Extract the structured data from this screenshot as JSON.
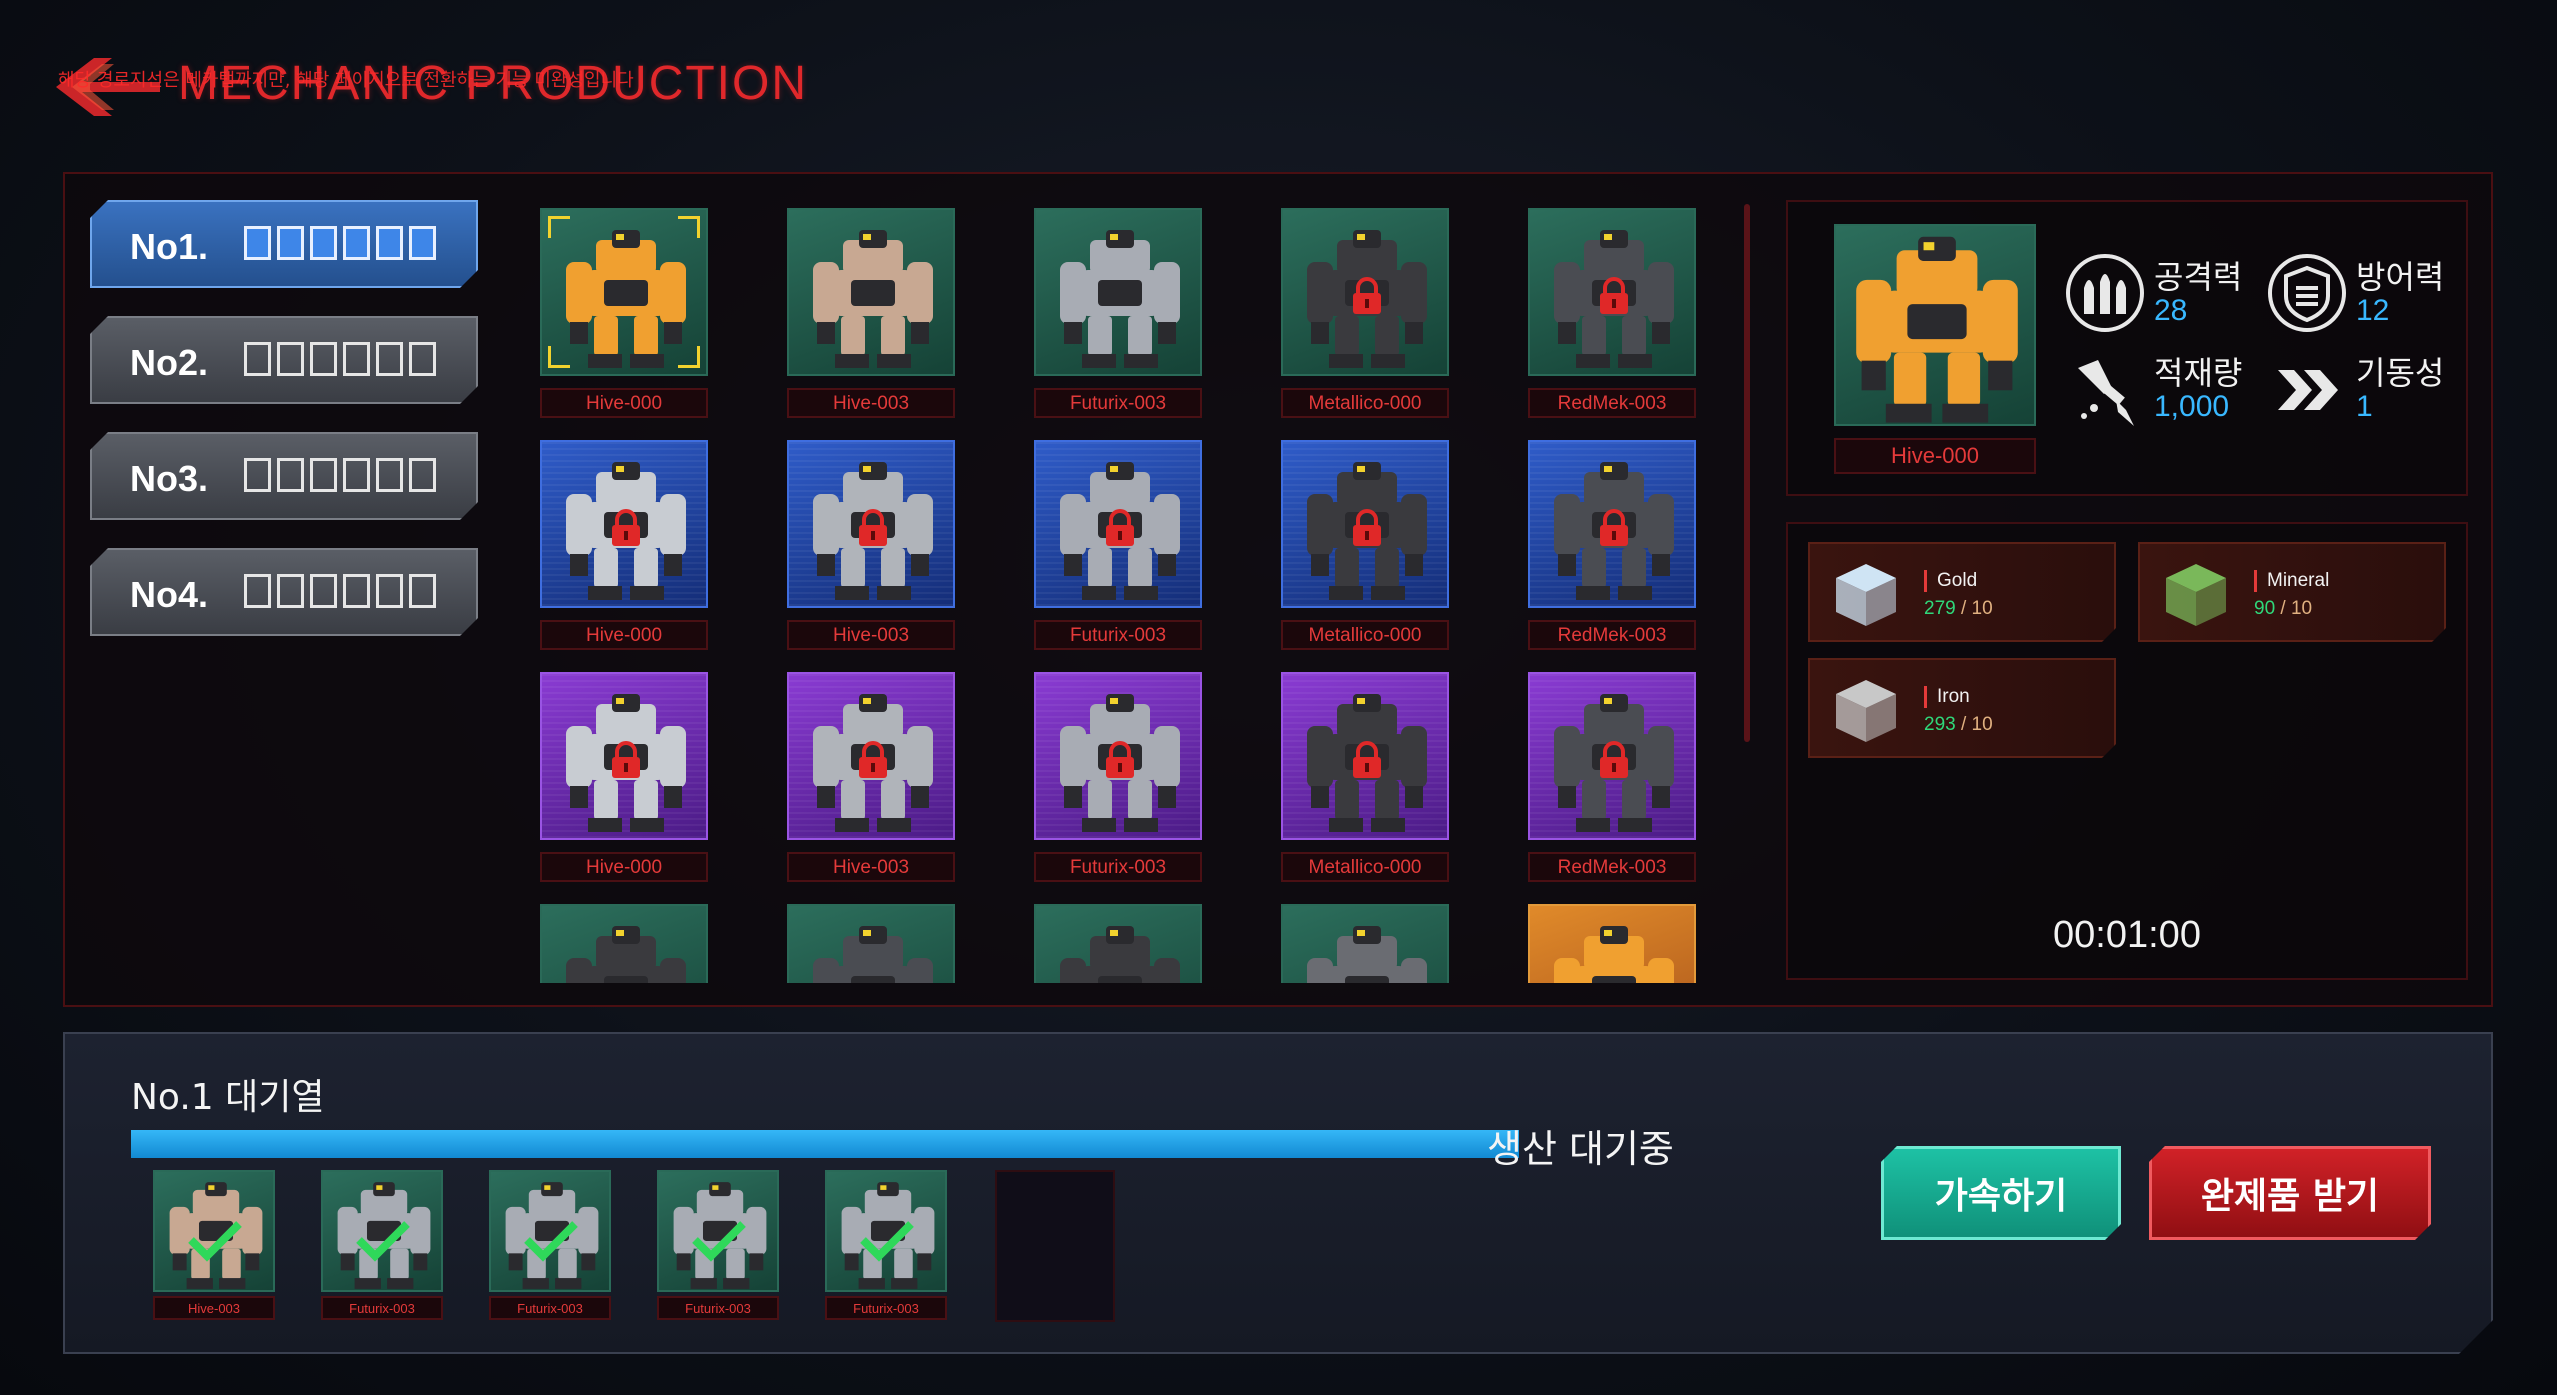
{
  "header": {
    "title": "MECHANIC PRODUCTION",
    "notice": "해당 경로지선은 메카탭까지만, 해당 페이지으로 전환하는 기능 미완성입니다",
    "back_icon": "back-arrow-icon"
  },
  "queue_tabs": [
    {
      "label": "No1.",
      "active": true
    },
    {
      "label": "No2.",
      "active": false
    },
    {
      "label": "No3.",
      "active": false
    },
    {
      "label": "No4.",
      "active": false
    }
  ],
  "grid": {
    "rows": [
      [
        {
          "name": "Hive-000",
          "bg": "green",
          "locked": false,
          "selected": true,
          "robot": "#f0a030"
        },
        {
          "name": "Hive-003",
          "bg": "green",
          "locked": false,
          "selected": false,
          "robot": "#c8a892"
        },
        {
          "name": "Futurix-003",
          "bg": "green",
          "locked": false,
          "selected": false,
          "robot": "#a8acb4"
        },
        {
          "name": "Metallico-000",
          "bg": "green",
          "locked": true,
          "selected": false,
          "robot": "#3a3a3e"
        },
        {
          "name": "RedMek-003",
          "bg": "green",
          "locked": true,
          "selected": false,
          "robot": "#4a4c52"
        }
      ],
      [
        {
          "name": "Hive-000",
          "bg": "blue",
          "locked": true,
          "selected": false,
          "robot": "#c8ccd2"
        },
        {
          "name": "Hive-003",
          "bg": "blue",
          "locked": true,
          "selected": false,
          "robot": "#b0b4ba"
        },
        {
          "name": "Futurix-003",
          "bg": "blue",
          "locked": true,
          "selected": false,
          "robot": "#a8acb4"
        },
        {
          "name": "Metallico-000",
          "bg": "blue",
          "locked": true,
          "selected": false,
          "robot": "#3a3a3e"
        },
        {
          "name": "RedMek-003",
          "bg": "blue",
          "locked": true,
          "selected": false,
          "robot": "#4a4c52"
        }
      ],
      [
        {
          "name": "Hive-000",
          "bg": "purple",
          "locked": true,
          "selected": false,
          "robot": "#c8ccd2"
        },
        {
          "name": "Hive-003",
          "bg": "purple",
          "locked": true,
          "selected": false,
          "robot": "#b0b4ba"
        },
        {
          "name": "Futurix-003",
          "bg": "purple",
          "locked": true,
          "selected": false,
          "robot": "#a8acb4"
        },
        {
          "name": "Metallico-000",
          "bg": "purple",
          "locked": true,
          "selected": false,
          "robot": "#3a3a3e"
        },
        {
          "name": "RedMek-003",
          "bg": "purple",
          "locked": true,
          "selected": false,
          "robot": "#4a4c52"
        }
      ],
      [
        {
          "name": "",
          "bg": "green",
          "locked": false,
          "selected": false,
          "robot": "#3a3a3e"
        },
        {
          "name": "",
          "bg": "green",
          "locked": false,
          "selected": false,
          "robot": "#4a4c52"
        },
        {
          "name": "",
          "bg": "green",
          "locked": false,
          "selected": false,
          "robot": "#3a3a3e"
        },
        {
          "name": "",
          "bg": "green",
          "locked": false,
          "selected": false,
          "robot": "#6a6c72"
        },
        {
          "name": "",
          "bg": "orange",
          "locked": false,
          "selected": false,
          "robot": "#f0a030"
        }
      ]
    ]
  },
  "detail": {
    "name": "Hive-000",
    "stats": {
      "attack": {
        "label": "공격력",
        "value": "28",
        "icon": "ammo-icon"
      },
      "defense": {
        "label": "방어력",
        "value": "12",
        "icon": "shield-icon"
      },
      "capacity": {
        "label": "적재량",
        "value": "1,000",
        "icon": "drill-icon"
      },
      "mobility": {
        "label": "기동성",
        "value": "1",
        "icon": "chevrons-icon"
      }
    }
  },
  "materials": [
    {
      "name": "Gold",
      "have": "279",
      "need": "10",
      "color": "#cfe4f4",
      "icon": "crystal-cube-icon"
    },
    {
      "name": "Mineral",
      "have": "90",
      "need": "10",
      "color": "#7ab85a",
      "icon": "green-cube-icon"
    },
    {
      "name": "Iron",
      "have": "293",
      "need": "10",
      "color": "#c8c8c8",
      "icon": "iron-cube-icon"
    }
  ],
  "timer": "00:01:00",
  "queue": {
    "title": "No.1 대기열",
    "status": "생산 대기중",
    "progress": 1.0,
    "items": [
      {
        "name": "Hive-003",
        "robot": "#c8a892"
      },
      {
        "name": "Futurix-003",
        "robot": "#a8acb4"
      },
      {
        "name": "Futurix-003",
        "robot": "#a8acb4"
      },
      {
        "name": "Futurix-003",
        "robot": "#a8acb4"
      },
      {
        "name": "Futurix-003",
        "robot": "#a8acb4"
      }
    ]
  },
  "buttons": {
    "speed_up": "가속하기",
    "collect": "완제품 받기"
  },
  "colors": {
    "accent_red": "#e0282b",
    "progress_blue": "#1a9ee6",
    "teal_button": "#14a58c",
    "red_button": "#b3181e"
  }
}
